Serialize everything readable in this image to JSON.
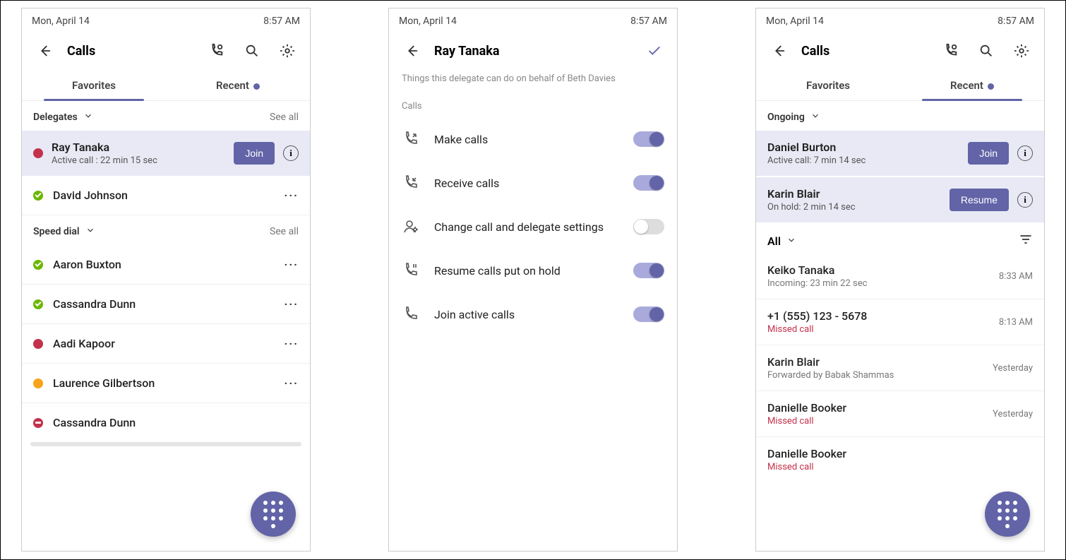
{
  "status": {
    "date": "Mon, April 14",
    "time": "8:57 AM"
  },
  "screen1": {
    "title": "Calls",
    "tabs": {
      "favorites": "Favorites",
      "recent": "Recent"
    },
    "delegates_label": "Delegates",
    "see_all": "See all",
    "active": {
      "name": "Ray Tanaka",
      "sub": "Active call : 22 min 15 sec",
      "join": "Join"
    },
    "contacts1": [
      {
        "name": "David Johnson"
      }
    ],
    "speed_label": "Speed dial",
    "speed": [
      {
        "name": "Aaron Buxton"
      },
      {
        "name": "Cassandra Dunn"
      },
      {
        "name": "Aadi Kapoor"
      },
      {
        "name": "Laurence Gilbertson"
      },
      {
        "name": "Cassandra Dunn"
      }
    ]
  },
  "screen2": {
    "title": "Ray Tanaka",
    "desc": "Things this delegate can do on behalf of Beth Davies",
    "section": "Calls",
    "perms": [
      {
        "label": "Make calls",
        "on": true
      },
      {
        "label": "Receive calls",
        "on": true
      },
      {
        "label": "Change call and delegate settings",
        "on": false
      },
      {
        "label": "Resume calls put on hold",
        "on": true
      },
      {
        "label": "Join active calls",
        "on": true
      }
    ]
  },
  "screen3": {
    "title": "Calls",
    "tabs": {
      "favorites": "Favorites",
      "recent": "Recent"
    },
    "ongoing_label": "Ongoing",
    "ongoing": [
      {
        "name": "Daniel Burton",
        "sub": "Active call: 7 min 14 sec",
        "action": "Join"
      },
      {
        "name": "Karin Blair",
        "sub": "On hold: 2 min 14 sec",
        "action": "Resume"
      }
    ],
    "all_label": "All",
    "history": [
      {
        "name": "Keiko Tanaka",
        "sub": "Incoming: 23 min 22 sec",
        "time": "8:33 AM",
        "missed": false
      },
      {
        "name": "+1 (555) 123 - 5678",
        "sub": "Missed call",
        "time": "8:13 AM",
        "missed": true
      },
      {
        "name": "Karin Blair",
        "sub": "Forwarded by Babak Shammas",
        "time": "Yesterday",
        "missed": false
      },
      {
        "name": "Danielle Booker",
        "sub": "Missed call",
        "time": "Yesterday",
        "missed": true
      },
      {
        "name": "Danielle Booker",
        "sub": "Missed call",
        "time": "",
        "missed": true
      }
    ]
  }
}
